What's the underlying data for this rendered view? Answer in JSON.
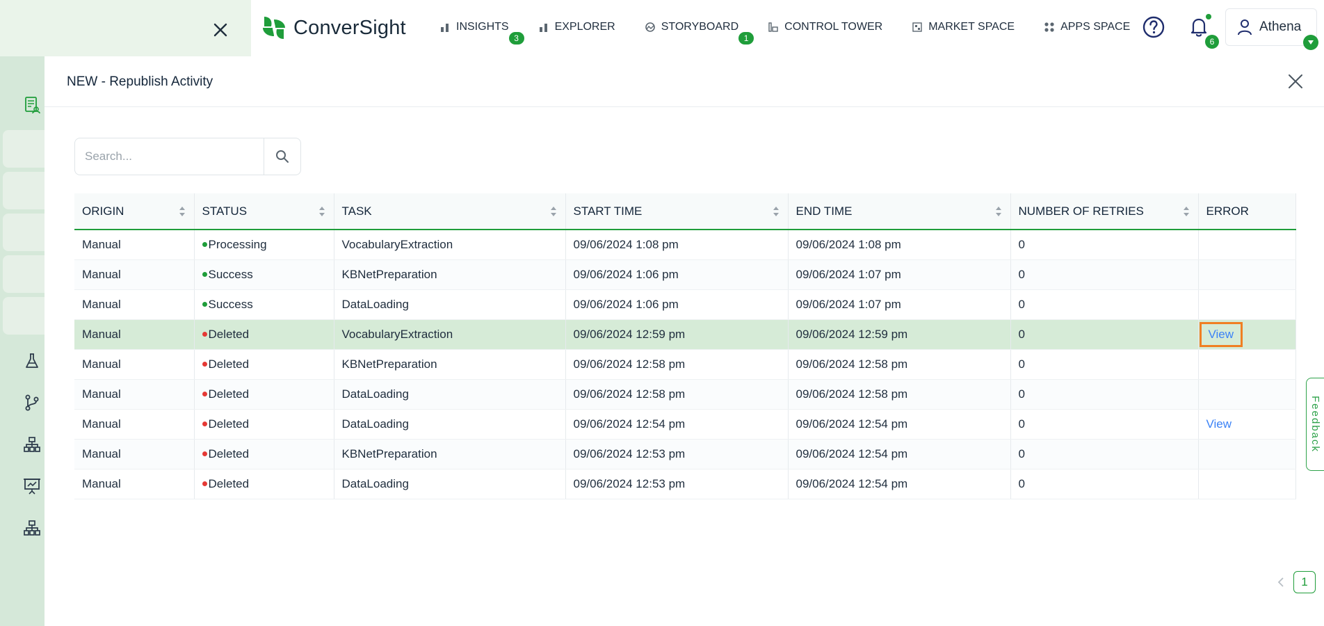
{
  "header": {
    "brand": "ConverSight",
    "nav": [
      {
        "label": "INSIGHTS",
        "icon": "bar-chart-icon",
        "badge": "3"
      },
      {
        "label": "EXPLORER",
        "icon": "bar-chart-icon",
        "badge": ""
      },
      {
        "label": "STORYBOARD",
        "icon": "storyboard-icon",
        "badge": "1"
      },
      {
        "label": "CONTROL TOWER",
        "icon": "control-tower-icon",
        "badge": ""
      },
      {
        "label": "MARKET SPACE",
        "icon": "market-space-icon",
        "badge": ""
      },
      {
        "label": "APPS SPACE",
        "icon": "apps-space-icon",
        "badge": ""
      }
    ],
    "notifications_count": "6",
    "user_name": "Athena"
  },
  "panel": {
    "title": "NEW - Republish Activity"
  },
  "search": {
    "placeholder": "Search..."
  },
  "table": {
    "columns": [
      "ORIGIN",
      "STATUS",
      "TASK",
      "START TIME",
      "END TIME",
      "NUMBER OF RETRIES",
      "ERROR"
    ],
    "rows": [
      {
        "origin": "Manual",
        "status": "Processing",
        "status_color": "#1f9d3a",
        "task": "VocabularyExtraction",
        "start": "09/06/2024 1:08 pm",
        "end": "09/06/2024 1:08 pm",
        "retries": "0",
        "error": ""
      },
      {
        "origin": "Manual",
        "status": "Success",
        "status_color": "#1f9d3a",
        "task": "KBNetPreparation",
        "start": "09/06/2024 1:06 pm",
        "end": "09/06/2024 1:07 pm",
        "retries": "0",
        "error": ""
      },
      {
        "origin": "Manual",
        "status": "Success",
        "status_color": "#1f9d3a",
        "task": "DataLoading",
        "start": "09/06/2024 1:06 pm",
        "end": "09/06/2024 1:07 pm",
        "retries": "0",
        "error": ""
      },
      {
        "origin": "Manual",
        "status": "Deleted",
        "status_color": "#e53935",
        "task": "VocabularyExtraction",
        "start": "09/06/2024 12:59 pm",
        "end": "09/06/2024 12:59 pm",
        "retries": "0",
        "error": "View"
      },
      {
        "origin": "Manual",
        "status": "Deleted",
        "status_color": "#e53935",
        "task": "KBNetPreparation",
        "start": "09/06/2024 12:58 pm",
        "end": "09/06/2024 12:58 pm",
        "retries": "0",
        "error": ""
      },
      {
        "origin": "Manual",
        "status": "Deleted",
        "status_color": "#e53935",
        "task": "DataLoading",
        "start": "09/06/2024 12:58 pm",
        "end": "09/06/2024 12:58 pm",
        "retries": "0",
        "error": ""
      },
      {
        "origin": "Manual",
        "status": "Deleted",
        "status_color": "#e53935",
        "task": "DataLoading",
        "start": "09/06/2024 12:54 pm",
        "end": "09/06/2024 12:54 pm",
        "retries": "0",
        "error": "View"
      },
      {
        "origin": "Manual",
        "status": "Deleted",
        "status_color": "#e53935",
        "task": "KBNetPreparation",
        "start": "09/06/2024 12:53 pm",
        "end": "09/06/2024 12:54 pm",
        "retries": "0",
        "error": ""
      },
      {
        "origin": "Manual",
        "status": "Deleted",
        "status_color": "#e53935",
        "task": "DataLoading",
        "start": "09/06/2024 12:53 pm",
        "end": "09/06/2024 12:54 pm",
        "retries": "0",
        "error": ""
      }
    ]
  },
  "pagination": {
    "current_page": "1"
  },
  "feedback": {
    "label": "Feedback"
  },
  "colors": {
    "accent": "#1f9d3a",
    "highlight_row": "#d6ebd7",
    "link": "#3b82f6",
    "focus_box": "#f07f23"
  }
}
